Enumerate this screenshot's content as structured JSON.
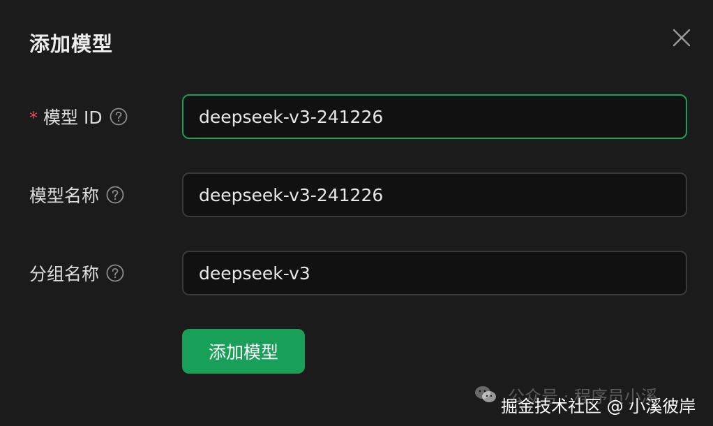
{
  "dialog": {
    "title": "添加模型",
    "close_icon": "close-icon"
  },
  "form": {
    "fields": [
      {
        "label": "模型 ID",
        "required": true,
        "value": "deepseek-v3-241226",
        "focused": true,
        "help_icon": "question-circle-icon"
      },
      {
        "label": "模型名称",
        "required": false,
        "value": "deepseek-v3-241226",
        "focused": false,
        "help_icon": "question-circle-icon"
      },
      {
        "label": "分组名称",
        "required": false,
        "value": "deepseek-v3",
        "focused": false,
        "help_icon": "question-circle-icon"
      }
    ],
    "required_mark": "*",
    "submit_label": "添加模型"
  },
  "watermark": {
    "line1": "公众号 · 程序员小溪",
    "line2": "掘金技术社区 @ 小溪彼岸",
    "icon": "wechat-icon"
  },
  "colors": {
    "background": "#1b1b1b",
    "accent": "#18a058",
    "required": "#e5484d",
    "input_bg": "#111111",
    "input_border": "#3a3a3a"
  }
}
